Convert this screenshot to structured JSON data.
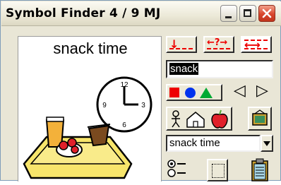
{
  "window": {
    "title": "Symbol Finder  4 / 9  MJ"
  },
  "symbol": {
    "label": "snack time",
    "icon": "snack-time-clock-tray-icon"
  },
  "toolbar": {
    "top_buttons": [
      "align-bottom-icon",
      "swap-icon",
      "stretch-icon"
    ],
    "top_button_marks": [
      "↓",
      "←?→",
      "⟷"
    ]
  },
  "search": {
    "value": "snack"
  },
  "shapes": [
    "red-square",
    "blue-circle",
    "green-triangle"
  ],
  "nav": {
    "prev": "◁",
    "next": "▷"
  },
  "dropdown": {
    "selected": "snack time"
  },
  "colors": {
    "red": "#ee0000",
    "blue": "#0033ee",
    "green": "#00aa33",
    "close": "#d9462d"
  }
}
